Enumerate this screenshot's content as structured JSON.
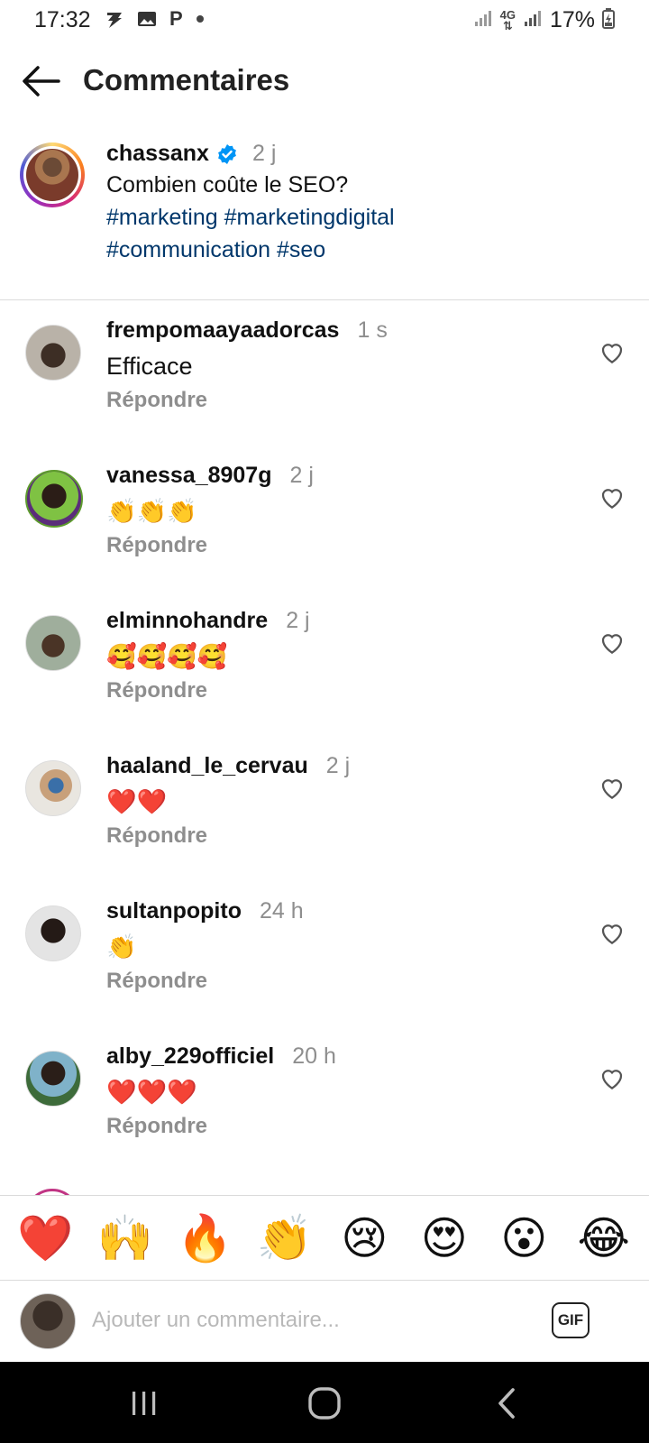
{
  "status_bar": {
    "time": "17:32",
    "battery": "17%",
    "network": "4G",
    "notif_letter": "P"
  },
  "header": {
    "title": "Commentaires",
    "back_icon": "arrow-left-icon"
  },
  "post": {
    "username": "chassanx",
    "verified": true,
    "time": "2 j",
    "text": "Combien coûte le SEO?",
    "hashtags_line1": "#marketing #marketingdigital",
    "hashtags_line2": "#communication #seo"
  },
  "comments": [
    {
      "username": "frempomaayaadorcas",
      "time": "1 s",
      "text": "Efficace",
      "reply": "Répondre"
    },
    {
      "username": "vanessa_8907g",
      "time": "2 j",
      "text": "👏👏👏",
      "reply": "Répondre"
    },
    {
      "username": "elminnohandre",
      "time": "2 j",
      "text": "🥰🥰🥰🥰",
      "reply": "Répondre"
    },
    {
      "username": "haaland_le_cervau",
      "time": "2 j",
      "text": "❤️❤️",
      "reply": "Répondre"
    },
    {
      "username": "sultanpopito",
      "time": "24 h",
      "text": "👏",
      "reply": "Répondre"
    },
    {
      "username": "alby_229officiel",
      "time": "20 h",
      "text": "❤️❤️❤️",
      "reply": "Répondre"
    }
  ],
  "quick_emojis": [
    "❤️",
    "🙌",
    "🔥",
    "👏",
    "😢",
    "😍",
    "😮",
    "😂"
  ],
  "composer": {
    "placeholder": "Ajouter un commentaire...",
    "gif_label": "GIF"
  },
  "colors": {
    "hashtag": "#00376b",
    "muted": "#8e8e8e",
    "verified": "#0095f6"
  }
}
